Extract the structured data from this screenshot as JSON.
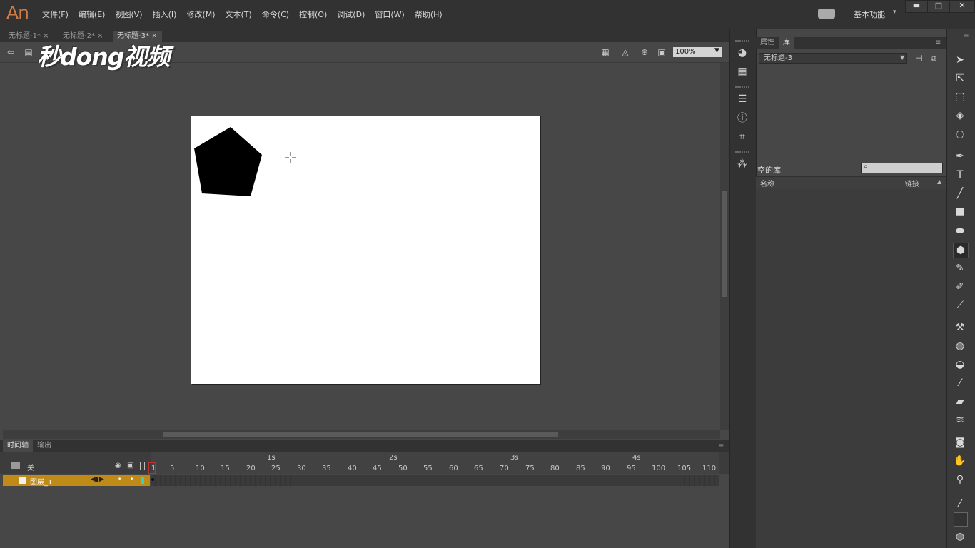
{
  "app": {
    "logo": "An"
  },
  "menu": [
    "文件(F)",
    "编辑(E)",
    "视图(V)",
    "插入(I)",
    "修改(M)",
    "文本(T)",
    "命令(C)",
    "控制(O)",
    "调试(D)",
    "窗口(W)",
    "帮助(H)"
  ],
  "workspace": {
    "label": "基本功能"
  },
  "window_controls": {
    "minimize": "▬",
    "maximize": "□",
    "close": "✕"
  },
  "doc_tabs": [
    {
      "label": "无标题-1* ×"
    },
    {
      "label": "无标题-2* ×"
    },
    {
      "label": "无标题-3* ×"
    }
  ],
  "watermark": "秒dong视频",
  "editbar": {
    "zoom": "100%"
  },
  "timeline": {
    "tabs": [
      "时间轴",
      "输出"
    ],
    "header_label": "关",
    "seconds": [
      "1s",
      "2s",
      "3s",
      "4s"
    ],
    "frames": [
      "1",
      "5",
      "10",
      "15",
      "20",
      "25",
      "30",
      "35",
      "40",
      "45",
      "50",
      "55",
      "60",
      "65",
      "70",
      "75",
      "80",
      "85",
      "90",
      "95",
      "100",
      "105",
      "110"
    ],
    "layer_name": "图层_1"
  },
  "library": {
    "tabs": [
      "属性",
      "库"
    ],
    "doc_select": "无标题-3",
    "empty_label": "空的库",
    "col_name": "名称",
    "col_link": "链接"
  },
  "colors": {
    "accent": "#c08a19",
    "logo": "#d07a45",
    "stage": "#ffffff",
    "playhead": "#c03030"
  }
}
